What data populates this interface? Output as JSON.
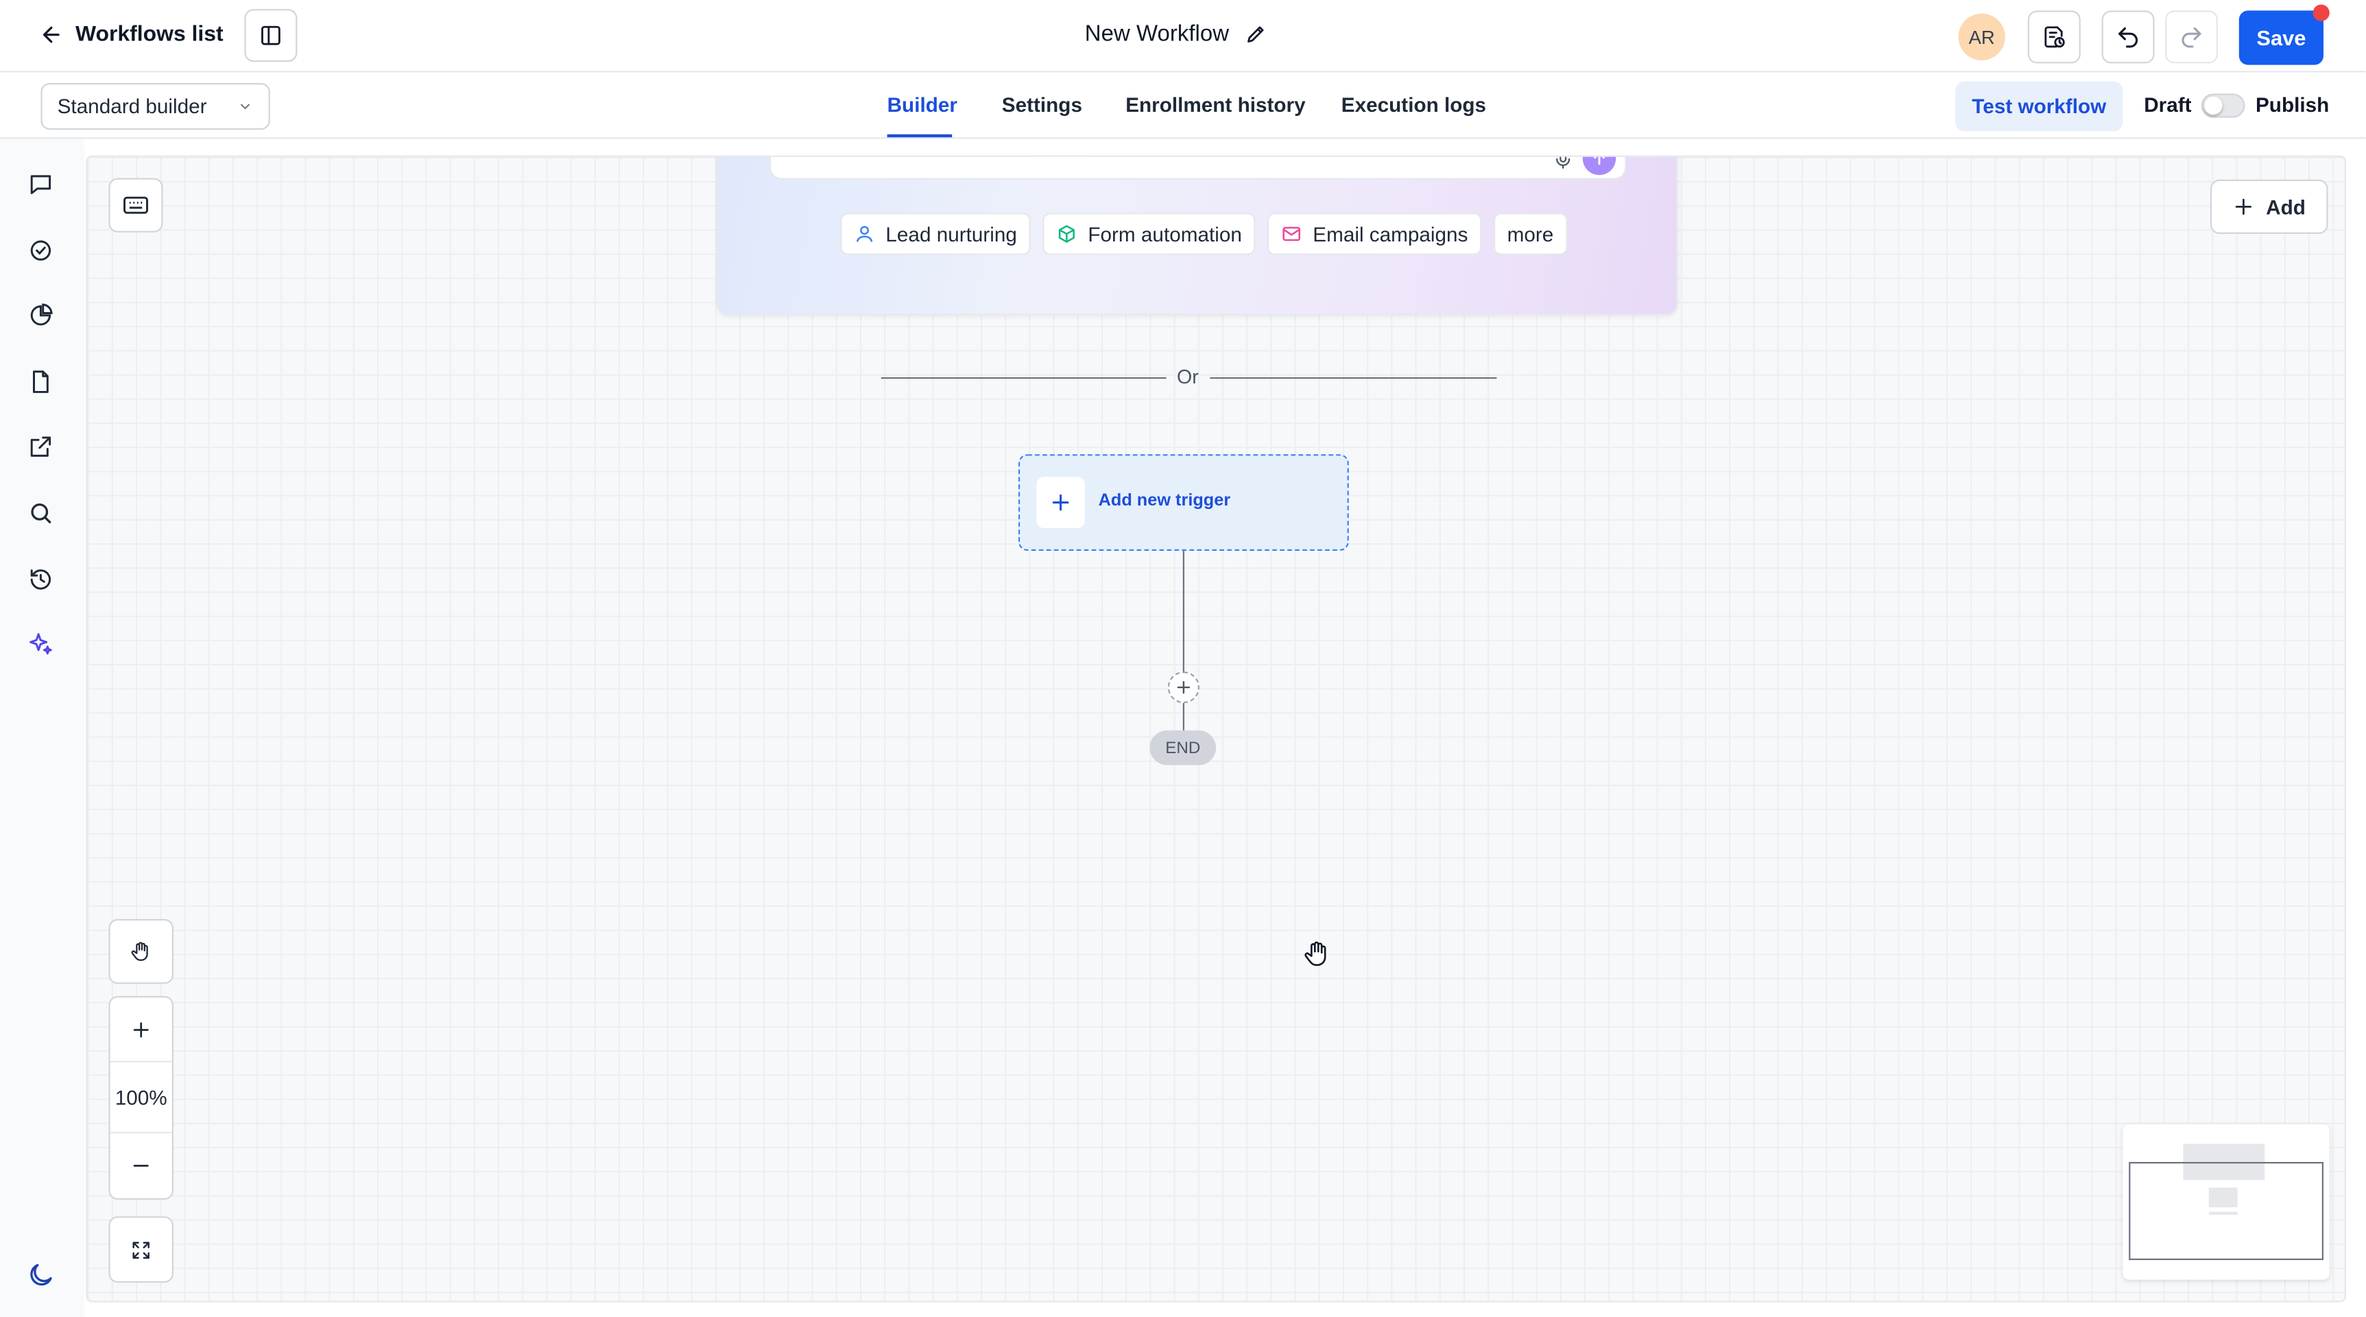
{
  "header": {
    "back_label": "Workflows list",
    "title": "New Workflow",
    "avatar_initials": "AR",
    "save_label": "Save"
  },
  "subbar": {
    "builder_select_value": "Standard builder",
    "tabs": [
      "Builder",
      "Settings",
      "Enrollment history",
      "Execution logs"
    ],
    "active_tab": "Builder",
    "test_label": "Test workflow",
    "draft_label": "Draft",
    "publish_label": "Publish",
    "publish_toggle_on": false
  },
  "rail": {
    "icons": [
      "chat-icon",
      "check-circle-icon",
      "pie-chart-icon",
      "document-icon",
      "external-link-icon",
      "search-icon",
      "history-icon",
      "sparkle-icon"
    ],
    "theme_icon": "moon-icon"
  },
  "canvas": {
    "add_label": "Add",
    "chips": [
      {
        "label": "Lead nurturing",
        "icon": "person-icon",
        "color": "#3b82f6"
      },
      {
        "label": "Form automation",
        "icon": "cube-icon",
        "color": "#10b981"
      },
      {
        "label": "Email campaigns",
        "icon": "mail-icon",
        "color": "#ec4899"
      },
      {
        "label": "more",
        "icon": "",
        "color": ""
      }
    ],
    "or_label": "Or",
    "trigger_label": "Add new trigger",
    "end_label": "END",
    "zoom_level": "100%"
  },
  "colors": {
    "accent": "#155eef",
    "tab_active": "#1d4ed8",
    "send_button": "#a78bfa",
    "notification_dot": "#ef4444"
  }
}
